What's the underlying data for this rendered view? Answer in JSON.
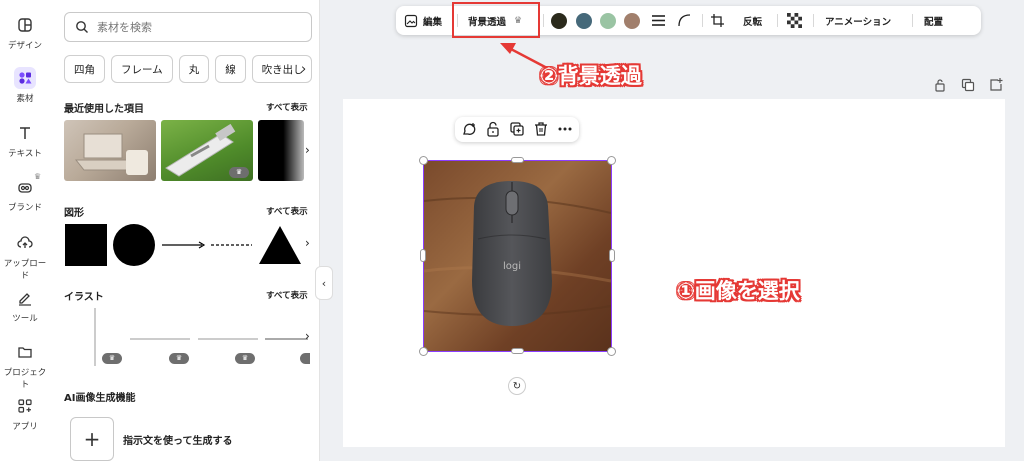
{
  "rail": {
    "items": [
      {
        "label": "デザイン",
        "icon": "layout-icon"
      },
      {
        "label": "素材",
        "icon": "elements-icon"
      },
      {
        "label": "テキスト",
        "icon": "text-icon"
      },
      {
        "label": "ブランド",
        "icon": "brand-icon"
      },
      {
        "label": "アップロード",
        "icon": "upload-icon"
      },
      {
        "label": "ツール",
        "icon": "draw-icon"
      },
      {
        "label": "プロジェクト",
        "icon": "folder-icon"
      },
      {
        "label": "アプリ",
        "icon": "apps-icon"
      }
    ]
  },
  "panel": {
    "search_placeholder": "素材を検索",
    "chips": [
      "四角",
      "フレーム",
      "丸",
      "線",
      "吹き出し"
    ],
    "recent_title": "最近使用した項目",
    "shapes_title": "図形",
    "illust_title": "イラスト",
    "see_all": "すべて表示",
    "ai_title": "AI画像生成機能",
    "ai_button_label": "指示文を使って生成する"
  },
  "toolbar": {
    "edit": "編集",
    "bg_remove": "背景透過",
    "flip": "反転",
    "animate": "アニメーション",
    "position": "配置",
    "colors": [
      "#2b2a1c",
      "#46697a",
      "#9ac4a3",
      "#a17f6c"
    ]
  },
  "annotations": {
    "step2": "②背景透過",
    "step1": "①画像を選択"
  },
  "accent": "#8b3dff",
  "annotation_color": "#e53935"
}
